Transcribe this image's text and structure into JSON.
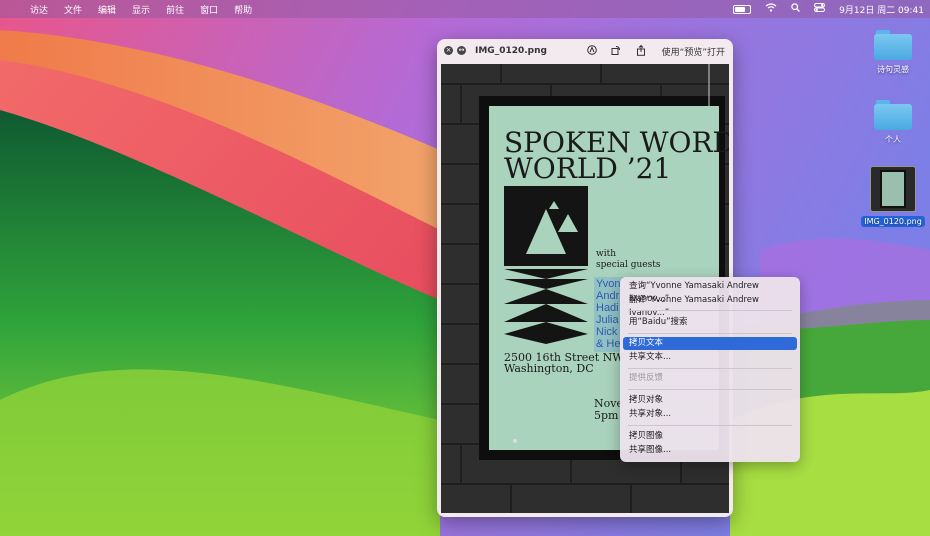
{
  "menubar": {
    "items": [
      "访达",
      "文件",
      "编辑",
      "显示",
      "前往",
      "窗口",
      "帮助"
    ],
    "clock": "9月12日 周二  09:41"
  },
  "desktop": {
    "items": [
      {
        "label": "诗句灵感",
        "type": "folder"
      },
      {
        "label": "个人",
        "type": "folder"
      },
      {
        "label": "IMG_0120.png",
        "type": "image",
        "selected": true
      }
    ]
  },
  "quicklook": {
    "title": "IMG_0120.png",
    "open_with": "使用“预览”打开"
  },
  "poster": {
    "title_line1": "SPOKEN WORD",
    "title_line2": "WORLD ’21",
    "with_line1": "with",
    "with_line2": "special guests",
    "names": [
      "Yvon",
      "Andr",
      "Hadi",
      "Julia",
      "Nick",
      "& He"
    ],
    "address_line1": "2500 16th Street NW",
    "address_line2": "Washington, DC",
    "date_line1": "Nove",
    "date_line2": "5pm"
  },
  "context_menu": {
    "items": [
      {
        "label": "查询“Yvonne Yamasaki Andrew Ivanov...”",
        "state": "normal"
      },
      {
        "label": "翻译“Yvonne Yamasaki Andrew Ivanov...”",
        "state": "normal"
      },
      {
        "label": "用“Baidu”搜索",
        "state": "normal"
      },
      {
        "label": "拷贝文本",
        "state": "highlighted"
      },
      {
        "label": "共享文本...",
        "state": "normal"
      },
      {
        "label": "提供反馈",
        "state": "disabled"
      },
      {
        "label": "拷贝对象",
        "state": "normal"
      },
      {
        "label": "共享对象...",
        "state": "normal"
      },
      {
        "label": "拷贝图像",
        "state": "normal"
      },
      {
        "label": "共享图像...",
        "state": "normal"
      }
    ]
  },
  "colors": {
    "highlight": "#2e6ad8",
    "poster_bg": "#a9d3bd",
    "folder": "#6fc0ee"
  }
}
